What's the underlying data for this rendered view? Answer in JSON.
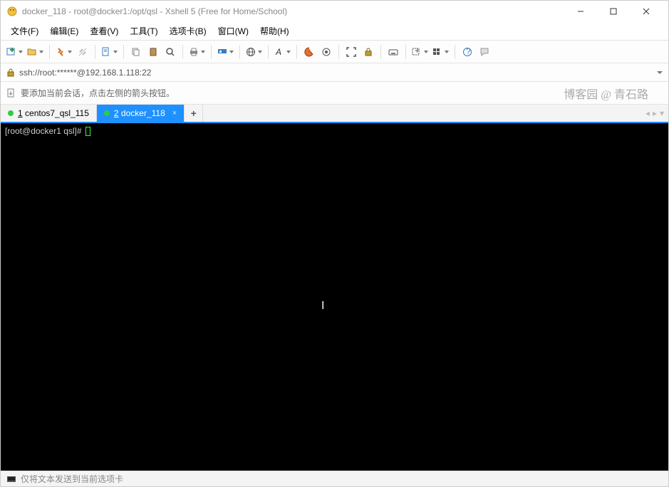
{
  "window": {
    "title": "docker_118 - root@docker1:/opt/qsl - Xshell 5 (Free for Home/School)"
  },
  "menus": {
    "file": "文件(F)",
    "edit": "编辑(E)",
    "view": "查看(V)",
    "tools": "工具(T)",
    "tabs": "选项卡(B)",
    "window": "窗口(W)",
    "help": "帮助(H)"
  },
  "address": {
    "url": "ssh://root:******@192.168.1.118:22"
  },
  "infobar": {
    "hint": "要添加当前会话，点击左侧的箭头按钮。",
    "watermark": "博客园 @ 青石路"
  },
  "tabs": [
    {
      "label_num": "1",
      "label_text": "centos7_qsl_115",
      "active": false
    },
    {
      "label_num": "2",
      "label_text": "docker_118",
      "active": true
    }
  ],
  "terminal": {
    "prompt": "[root@docker1 qsl]#"
  },
  "statusbar": {
    "text": "仅将文本发送到当前选项卡"
  }
}
